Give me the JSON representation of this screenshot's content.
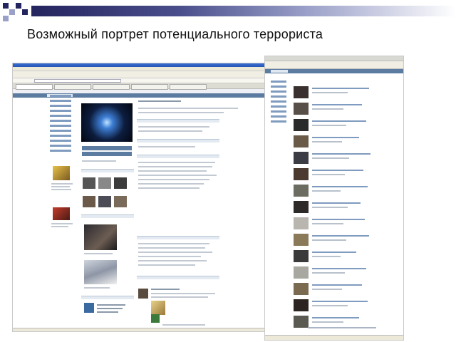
{
  "slide": {
    "title": "Возможный портрет потенциального террориста"
  },
  "colors": {
    "deco_dark": "#24245e",
    "deco_light": "#9aa0c8",
    "vk_header": "#5b7ba0",
    "vk_link": "#7f9bbf",
    "browser_chrome": "#ece9d8"
  },
  "screenshots": [
    {
      "name": "vk-profile-page",
      "description_visible": "social network profile page in a browser window"
    },
    {
      "name": "vk-video-list",
      "description_visible": "list of video entries with thumbnails"
    }
  ],
  "icons": {
    "avatar": "avatar-image",
    "video_thumb": "video-thumbnail"
  }
}
